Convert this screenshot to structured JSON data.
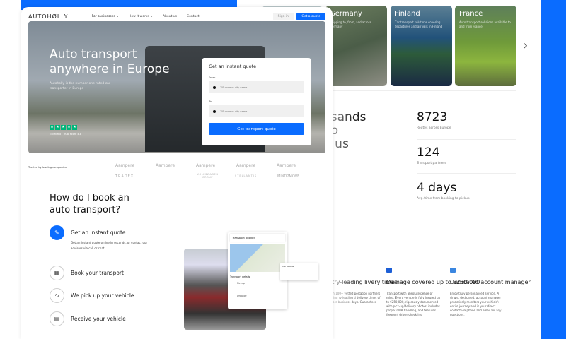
{
  "colors": {
    "accent": "#0a6cff",
    "trustpilot": "#00b67a"
  },
  "back": {
    "cards": [
      {
        "title": "Germany",
        "desc": "Shipping to, from, and across Germany"
      },
      {
        "title": "Finland",
        "desc": "Car transport solutions covering departures and arrivals in Finland"
      },
      {
        "title": "France",
        "desc": "Auto transport solutions available to and from France"
      }
    ],
    "headline": [
      "usands",
      "ho",
      "h us"
    ],
    "stats": [
      {
        "value": "8723",
        "label": "Routes across Europe"
      },
      {
        "value": "124",
        "label": "Transport partners"
      },
      {
        "value": "4 days",
        "label": "Avg. time from booking to pickup"
      }
    ],
    "features": [
      {
        "title": "ustry-leading livery times",
        "desc": "rt with 100+ vetted portation partners ensuring ry-leading d delivery times of no more business days. Guaranteed"
      },
      {
        "title": "Damage covered up to €250.000",
        "desc": "Transport with absolute peace of mind. Every vehicle is fully insured up to €250,000, rigorously documented with pick-up/delivery photos, includes proper CMR handling, and features frequent driver check ins."
      },
      {
        "title": "Dedicated account manager",
        "desc": "Enjoy truly personalised service. A single, dedicated, account manager proactively monitors your vehicle's entire journey and is your direct contact via phone and email for any questions."
      }
    ]
  },
  "front": {
    "logo": "AUTOHØLLY",
    "nav": [
      "For businesses ⌄",
      "How it works ⌄",
      "About us",
      "Contact"
    ],
    "sign_in": "Sign in",
    "get_quote": "Get a quote",
    "hero_title": "Auto transport anywhere in Europe",
    "hero_sub": "Autoholly is the number one rated car transporter in Europe",
    "rating": "Excellent · Trust score 4.8",
    "quote": {
      "title": "Get an instant quote",
      "from_label": "From",
      "to_label": "To",
      "placeholder": "ZIP code or city name",
      "button": "Get transport quote"
    },
    "trusted": "Trusted by leading companies",
    "brands": [
      "Aampere",
      "Aampere",
      "Aampere",
      "Aampere",
      "Aampere",
      "TRADEX",
      "VOLKSWAGEN GROUP",
      "STELLANTIS",
      "MIND2MOVE"
    ],
    "how_title": "How do I book an auto transport?",
    "steps": [
      "Get an instant quote",
      "Book your transport",
      "We pick up your vehicle",
      "Receive your vehicle"
    ],
    "step1_desc": "Get an instant quote online in seconds, or contact our advisors via call or chat.",
    "illustration": {
      "booked": "Transport booked",
      "details": "Transport details",
      "car": "Car details",
      "pickup": "Pickup",
      "dropoff": "Drop off"
    }
  }
}
